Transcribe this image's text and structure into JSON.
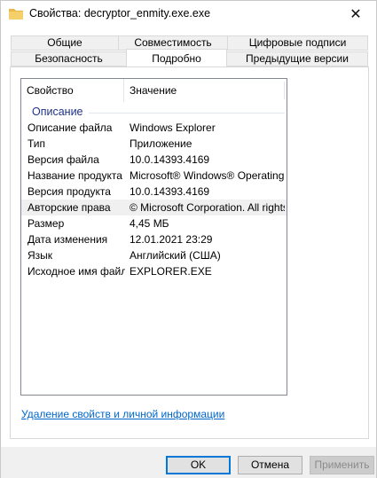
{
  "window": {
    "title": "Свойства: decryptor_enmity.exe.exe"
  },
  "tabs": {
    "row1": [
      "Общие",
      "Совместимость",
      "Цифровые подписи"
    ],
    "row2": [
      "Безопасность",
      "Подробно",
      "Предыдущие версии"
    ],
    "active": "Подробно"
  },
  "details": {
    "columns": [
      "Свойство",
      "Значение"
    ],
    "group": "Описание",
    "rows": [
      {
        "key": "Описание файла",
        "value": "Windows Explorer"
      },
      {
        "key": "Тип",
        "value": "Приложение"
      },
      {
        "key": "Версия файла",
        "value": "10.0.14393.4169"
      },
      {
        "key": "Название продукта",
        "value": "Microsoft® Windows® Operating ..."
      },
      {
        "key": "Версия продукта",
        "value": "10.0.14393.4169"
      },
      {
        "key": "Авторские права",
        "value": "© Microsoft Corporation. All rights ..."
      },
      {
        "key": "Размер",
        "value": "4,45 МБ"
      },
      {
        "key": "Дата изменения",
        "value": "12.01.2021 23:29"
      },
      {
        "key": "Язык",
        "value": "Английский (США)"
      },
      {
        "key": "Исходное имя файла",
        "value": "EXPLORER.EXE"
      }
    ],
    "selected_row": "Авторские права"
  },
  "remove_link": "Удаление свойств и личной информации",
  "buttons": {
    "ok": "OK",
    "cancel": "Отмена",
    "apply": "Применить"
  },
  "colors": {
    "group_heading": "#1e3287",
    "link": "#0066cc",
    "default_button_border": "#0078d7"
  }
}
